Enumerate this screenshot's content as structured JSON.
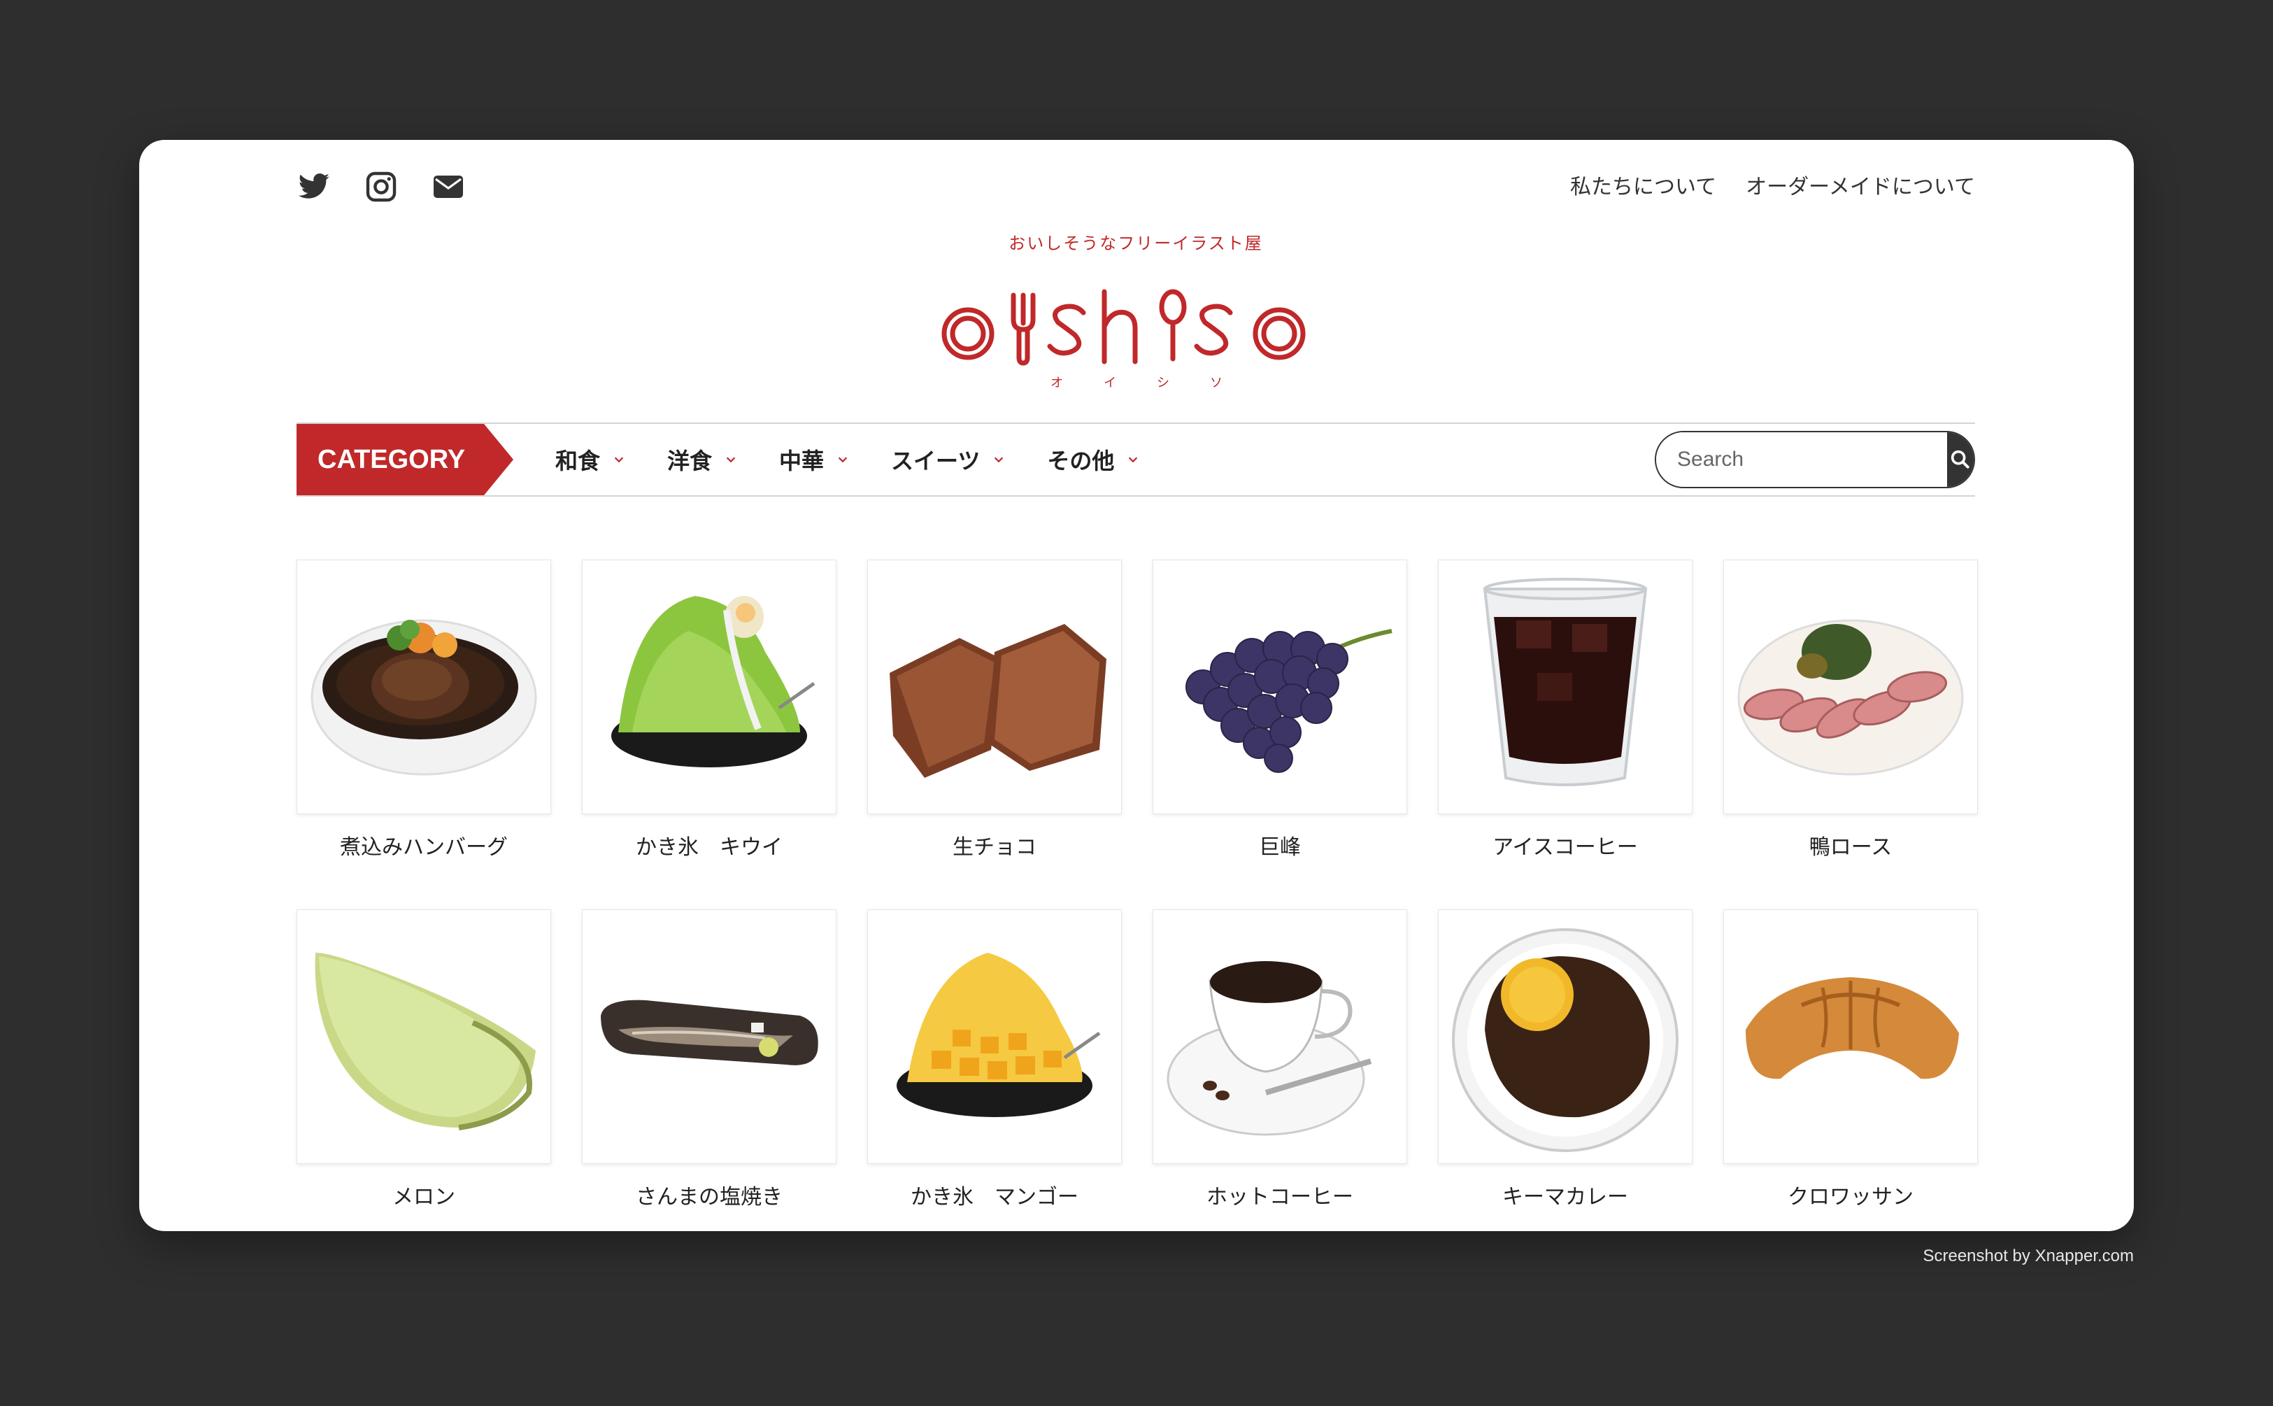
{
  "header": {
    "social": [
      {
        "name": "twitter-icon"
      },
      {
        "name": "instagram-icon"
      },
      {
        "name": "mail-icon"
      }
    ],
    "links": [
      "私たちについて",
      "オーダーメイドについて"
    ]
  },
  "logo": {
    "tagline": "おいしそうなフリーイラスト屋",
    "wordmark": "oishiso",
    "kana": "オイシソ",
    "color": "#c0282a"
  },
  "nav": {
    "category_label": "CATEGORY",
    "items": [
      "和食",
      "洋食",
      "中華",
      "スイーツ",
      "その他"
    ],
    "search_placeholder": "Search"
  },
  "items": [
    {
      "label": "煮込みハンバーグ",
      "icon": "hamburg-steak"
    },
    {
      "label": "かき氷　キウイ",
      "icon": "kiwi-shaved-ice"
    },
    {
      "label": "生チョコ",
      "icon": "nama-chocolate"
    },
    {
      "label": "巨峰",
      "icon": "grapes"
    },
    {
      "label": "アイスコーヒー",
      "icon": "iced-coffee"
    },
    {
      "label": "鴨ロース",
      "icon": "duck-roast"
    },
    {
      "label": "メロン",
      "icon": "melon"
    },
    {
      "label": "さんまの塩焼き",
      "icon": "grilled-saury"
    },
    {
      "label": "かき氷　マンゴー",
      "icon": "mango-shaved-ice"
    },
    {
      "label": "ホットコーヒー",
      "icon": "hot-coffee"
    },
    {
      "label": "キーマカレー",
      "icon": "keema-curry"
    },
    {
      "label": "クロワッサン",
      "icon": "croissant"
    }
  ],
  "footer": {
    "credit": "Screenshot by Xnapper.com"
  }
}
